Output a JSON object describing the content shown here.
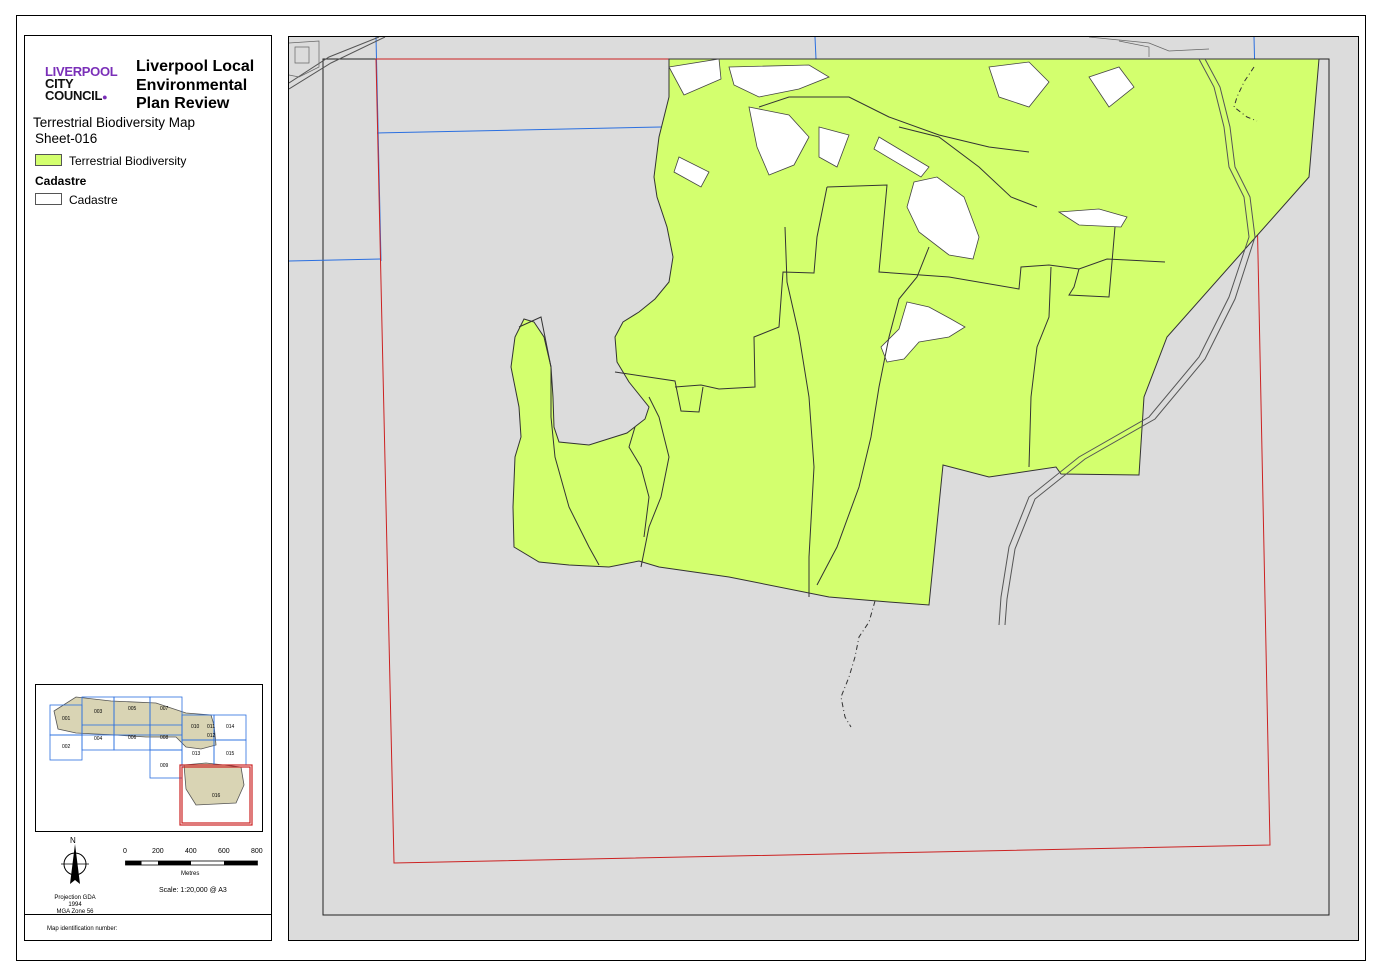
{
  "logo": {
    "line1": "LIVERPOOL",
    "line2": "CITY",
    "line3": "COUNCIL"
  },
  "title": "Liverpool Local Environmental Plan Review",
  "map_name": "Terrestrial Biodiversity Map",
  "sheet": "Sheet-016",
  "legend": {
    "items": [
      {
        "label": "Terrestrial Biodiversity",
        "color": "#d3ff6e"
      }
    ],
    "cadastre_heading": "Cadastre",
    "cadastre_item": {
      "label": "Cadastre",
      "color": "#ffffff"
    }
  },
  "inset": {
    "sheets": [
      "001",
      "002",
      "003",
      "004",
      "005",
      "006",
      "007",
      "008",
      "009",
      "010",
      "011",
      "012",
      "013",
      "014",
      "015",
      "016"
    ],
    "highlight": "016"
  },
  "north_label": "N",
  "scale": {
    "ticks": [
      "0",
      "200",
      "400",
      "600",
      "800"
    ],
    "unit": "Metres",
    "text": "Scale: 1:20,000 @ A3"
  },
  "projection": {
    "line1": "Projection GDA 1994",
    "line2": "MGA Zone 56"
  },
  "map_id_label": "Map identification number:",
  "colors": {
    "biodiversity": "#d3ff6e",
    "background": "#dcdcdc",
    "sheet_boundary": "#cc2222",
    "grid_lines": "#2a6fe0"
  }
}
